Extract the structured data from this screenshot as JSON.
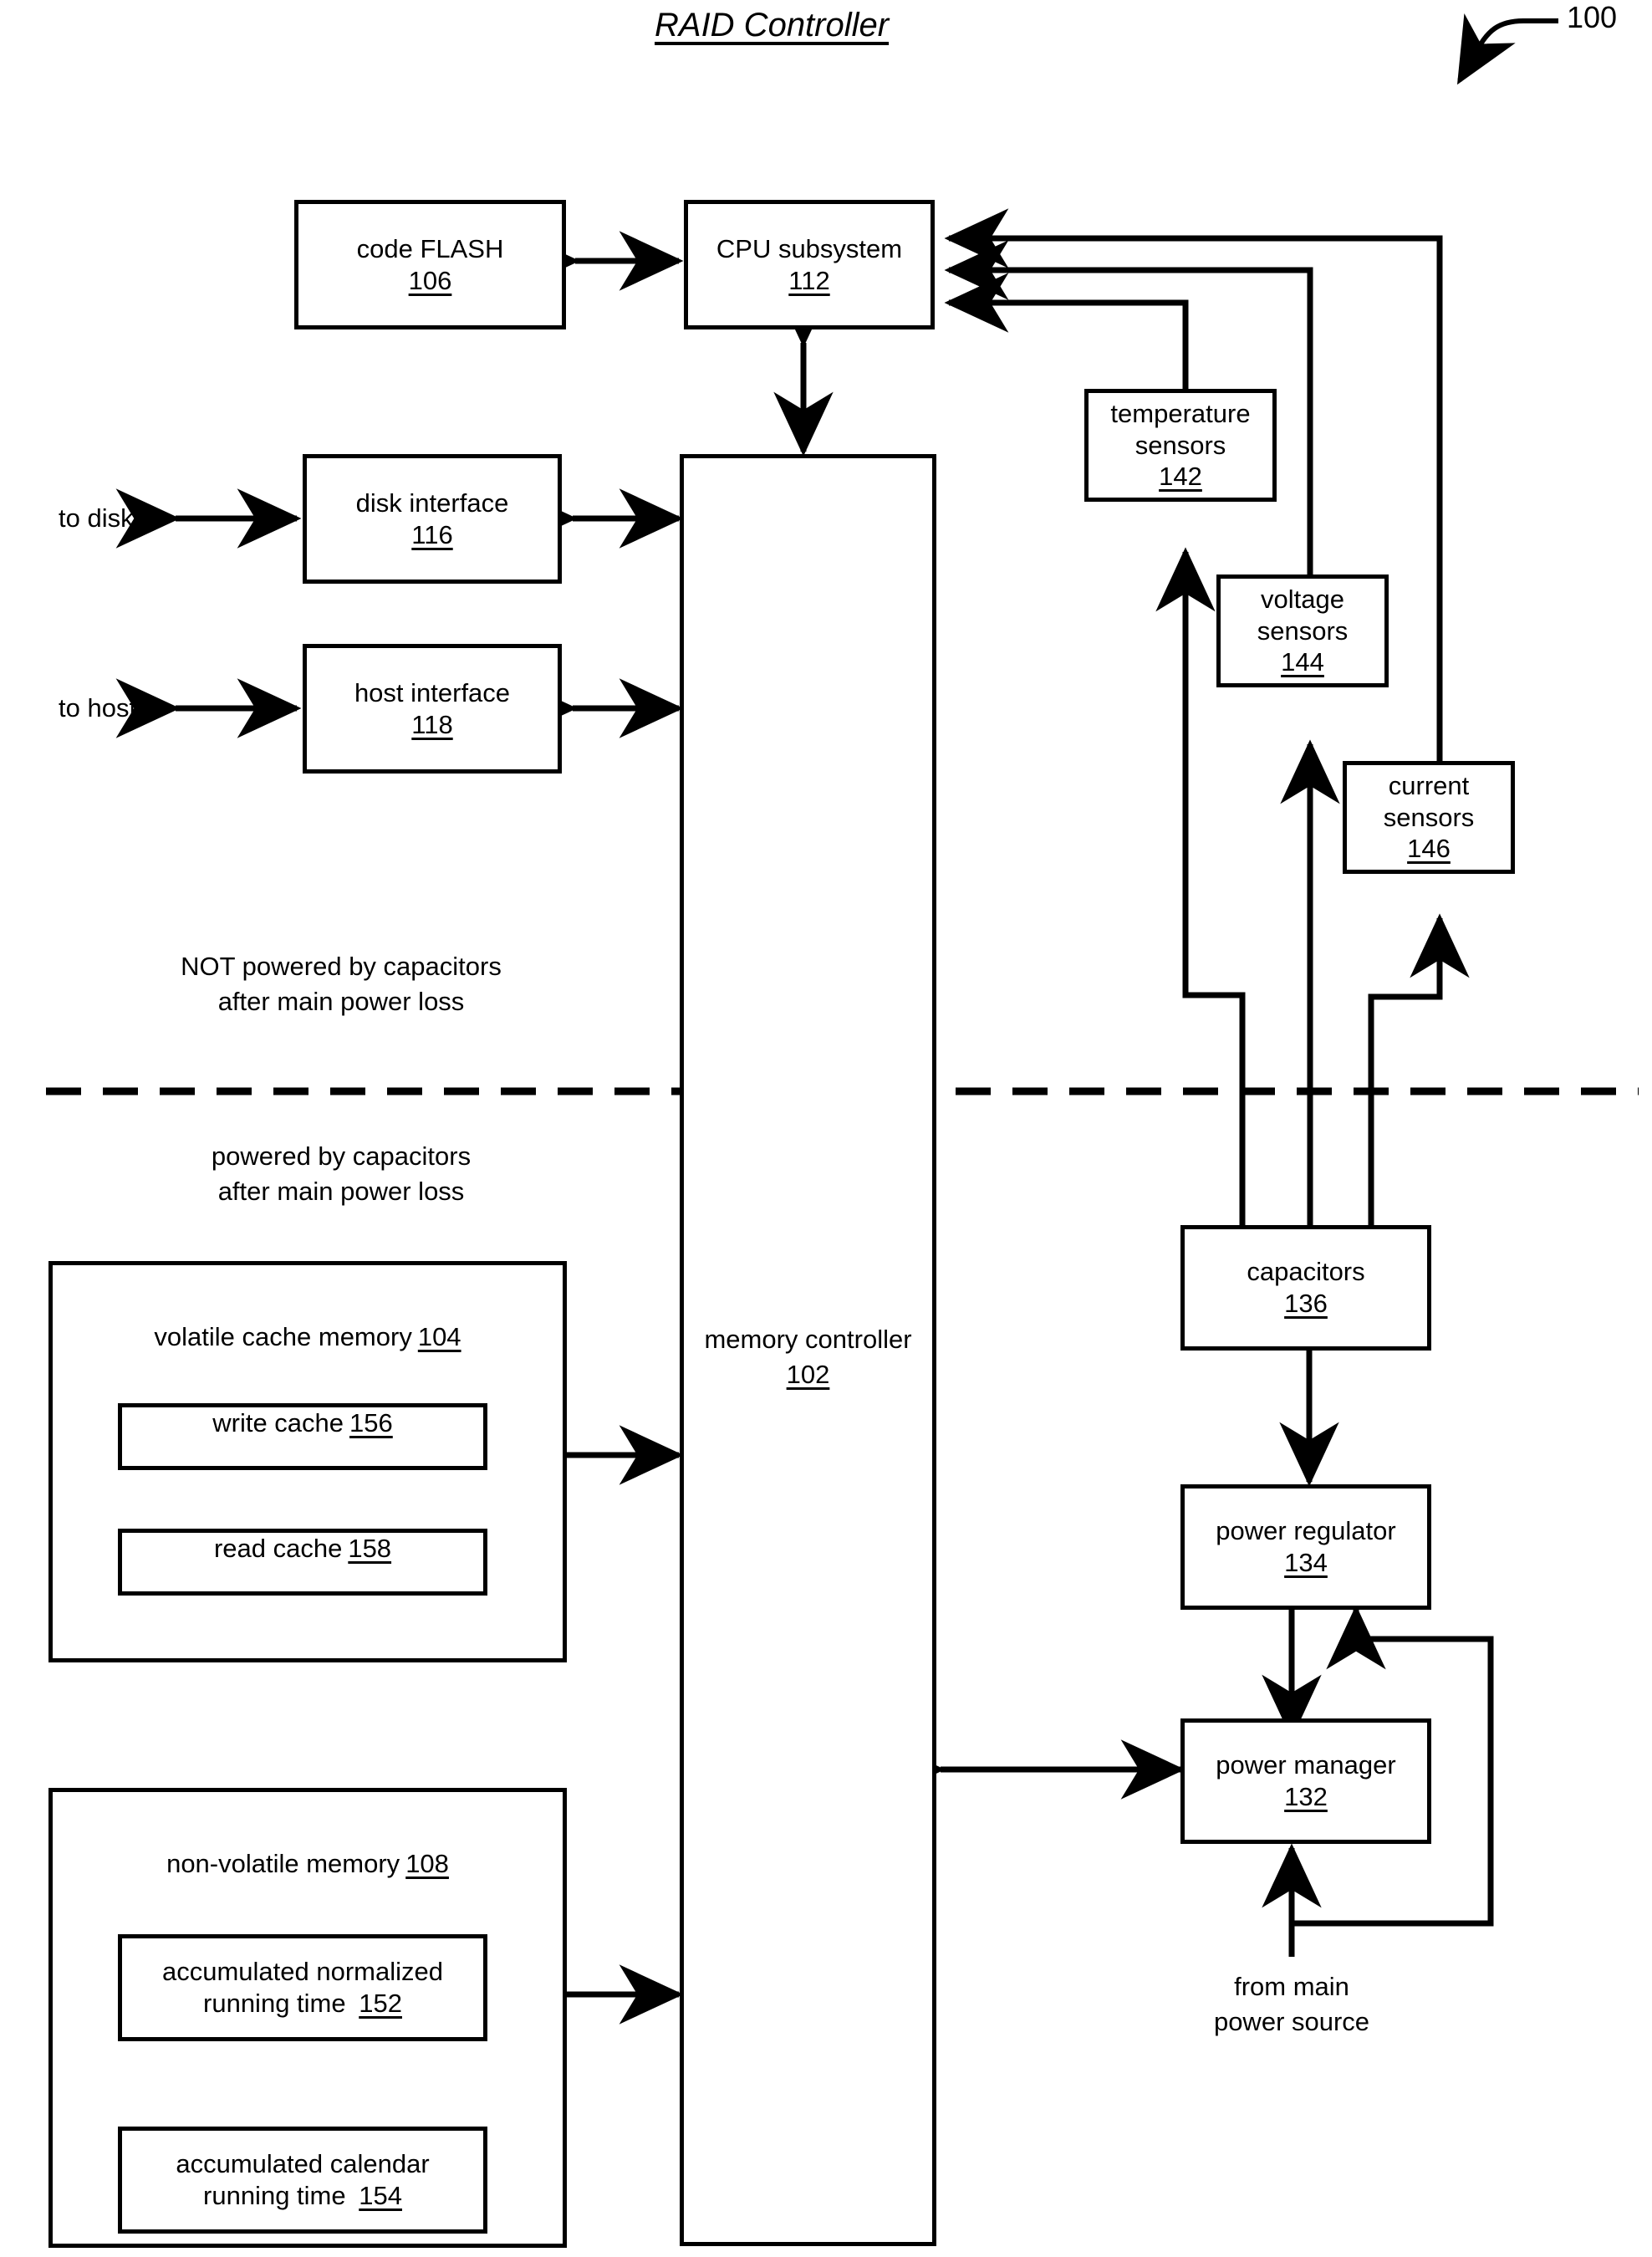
{
  "figure": {
    "title": "RAID Controller",
    "ref_number": "100"
  },
  "boxes": {
    "code_flash": {
      "label": "code FLASH",
      "ref": "106"
    },
    "cpu_subsystem": {
      "label": "CPU subsystem",
      "ref": "112"
    },
    "disk_interface": {
      "label": "disk interface",
      "ref": "116"
    },
    "host_interface": {
      "label": "host interface",
      "ref": "118"
    },
    "memory_controller": {
      "label": "memory controller",
      "ref": "102"
    },
    "temperature_sensors": {
      "label_line1": "temperature",
      "label_line2": "sensors",
      "ref": "142"
    },
    "voltage_sensors": {
      "label_line1": "voltage",
      "label_line2": "sensors",
      "ref": "144"
    },
    "current_sensors": {
      "label_line1": "current",
      "label_line2": "sensors",
      "ref": "146"
    },
    "capacitors": {
      "label": "capacitors",
      "ref": "136"
    },
    "power_regulator": {
      "label": "power regulator",
      "ref": "134"
    },
    "power_manager": {
      "label": "power manager",
      "ref": "132"
    },
    "volatile_cache_memory": {
      "label": "volatile cache memory",
      "ref": "104"
    },
    "write_cache": {
      "label": "write cache",
      "ref": "156"
    },
    "read_cache": {
      "label": "read cache",
      "ref": "158"
    },
    "non_volatile_memory": {
      "label": "non-volatile memory",
      "ref": "108"
    },
    "accumulated_normalized_running_time": {
      "label_line1": "accumulated normalized",
      "label_line2": "running time",
      "ref": "152"
    },
    "accumulated_calendar_running_time": {
      "label_line1": "accumulated calendar",
      "label_line2": "running time",
      "ref": "154"
    }
  },
  "labels": {
    "to_disks": "to disks",
    "to_hosts": "to hosts",
    "not_powered_line1": "NOT powered by capacitors",
    "not_powered_line2": "after main power loss",
    "powered_line1": "powered by capacitors",
    "powered_line2": "after main power loss",
    "from_main_line1": "from main",
    "from_main_line2": "power source"
  },
  "colors": {
    "line": "#000000",
    "background": "#ffffff"
  }
}
